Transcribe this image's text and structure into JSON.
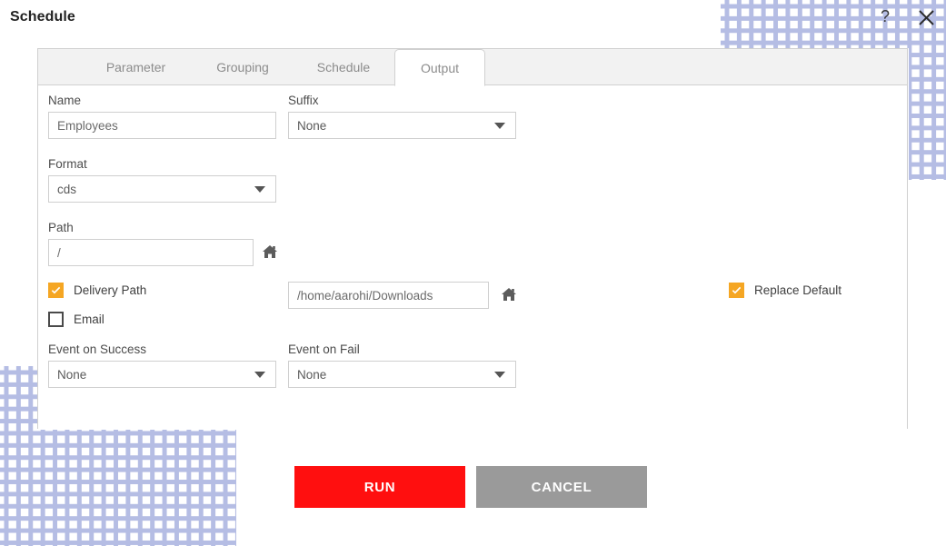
{
  "window": {
    "title": "Schedule",
    "help_icon": "question-mark-icon",
    "close_icon": "close-icon"
  },
  "tabs": [
    {
      "label": "Parameter",
      "active": false
    },
    {
      "label": "Grouping",
      "active": false
    },
    {
      "label": "Schedule",
      "active": false
    },
    {
      "label": "Output",
      "active": true
    }
  ],
  "form": {
    "name": {
      "label": "Name",
      "value": "Employees",
      "placeholder": ""
    },
    "suffix": {
      "label": "Suffix",
      "value": "None"
    },
    "format": {
      "label": "Format",
      "value": "cds"
    },
    "path": {
      "label": "Path",
      "value": "/",
      "placeholder": "/",
      "browse_icon": "home-icon"
    },
    "delivery_path": {
      "label": "Delivery Path",
      "checked": true,
      "value": "/home/aarohi/Downloads",
      "browse_icon": "home-icon"
    },
    "email": {
      "label": "Email",
      "checked": false
    },
    "replace_default": {
      "label": "Replace Default",
      "checked": true
    },
    "event_on_success": {
      "label": "Event on Success",
      "value": "None"
    },
    "event_on_fail": {
      "label": "Event on Fail",
      "value": "None"
    }
  },
  "actions": {
    "run_label": "RUN",
    "cancel_label": "CANCEL"
  },
  "colors": {
    "run_red": "#ff0f0f",
    "cancel_gray": "#9a9a9a",
    "checkbox_orange": "#f5a623",
    "pattern_blue": "#a9b2e0"
  }
}
